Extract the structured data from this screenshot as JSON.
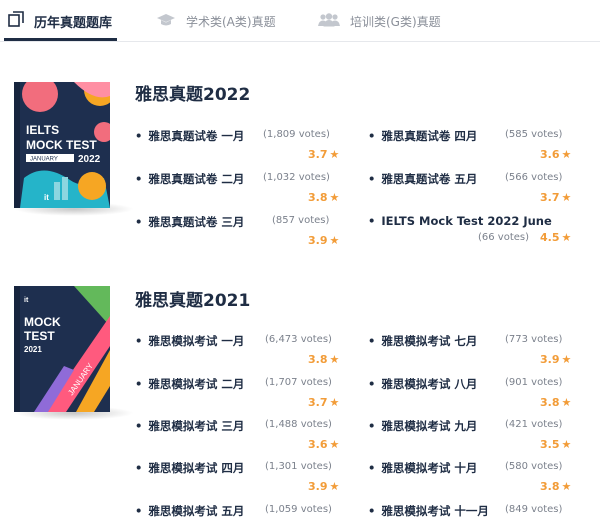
{
  "tabs": [
    {
      "label": "历年真题题库",
      "icon": "copy-icon",
      "active": true
    },
    {
      "label": "学术类(A类)真题",
      "icon": "graduation-cap-icon",
      "active": false
    },
    {
      "label": "培训类(G类)真题",
      "icon": "users-icon",
      "active": false
    }
  ],
  "colors": {
    "accent": "#1f2d44",
    "star": "#f29c38",
    "muted": "#7b818c"
  },
  "sections": [
    {
      "title": "雅思真题2022",
      "cover": {
        "line1": "IELTS",
        "line2": "MOCK TEST",
        "month": "JANUARY",
        "year": "2022",
        "logo": "it"
      },
      "left": [
        {
          "name": "雅思真题试卷 一月",
          "votes": "(1,809 votes)",
          "rating": "3.7"
        },
        {
          "name": "雅思真题试卷 二月",
          "votes": "(1,032 votes)",
          "rating": "3.8"
        },
        {
          "name": "雅思真题试卷 三月",
          "votes": "(857 votes)",
          "rating": "3.9"
        }
      ],
      "right": [
        {
          "name": "雅思真题试卷 四月",
          "votes": "(585 votes)",
          "rating": "3.6"
        },
        {
          "name": "雅思真题试卷 五月",
          "votes": "(566 votes)",
          "rating": "3.7"
        },
        {
          "name": "IELTS Mock Test 2022 June",
          "votes": "(66 votes)",
          "rating": "4.5"
        }
      ]
    },
    {
      "title": "雅思真题2021",
      "cover": {
        "line1": "MOCK",
        "line2": "TEST",
        "month": "JANUARY",
        "year": "2021",
        "logo": "it"
      },
      "left": [
        {
          "name": "雅思模拟考试 一月",
          "votes": "(6,473 votes)",
          "rating": "3.8"
        },
        {
          "name": "雅思模拟考试 二月",
          "votes": "(1,707 votes)",
          "rating": "3.7"
        },
        {
          "name": "雅思模拟考试 三月",
          "votes": "(1,488 votes)",
          "rating": "3.6"
        },
        {
          "name": "雅思模拟考试 四月",
          "votes": "(1,301 votes)",
          "rating": "3.9"
        },
        {
          "name": "雅思模拟考试 五月",
          "votes": "(1,059 votes)",
          "rating": ""
        }
      ],
      "right": [
        {
          "name": "雅思模拟考试 七月",
          "votes": "(773 votes)",
          "rating": "3.9"
        },
        {
          "name": "雅思模拟考试 八月",
          "votes": "(901 votes)",
          "rating": "3.8"
        },
        {
          "name": "雅思模拟考试 九月",
          "votes": "(421 votes)",
          "rating": "3.5"
        },
        {
          "name": "雅思模拟考试 十月",
          "votes": "(580 votes)",
          "rating": "3.8"
        },
        {
          "name": "雅思模拟考试 十一月",
          "votes": "(849 votes)",
          "rating": ""
        }
      ]
    }
  ]
}
